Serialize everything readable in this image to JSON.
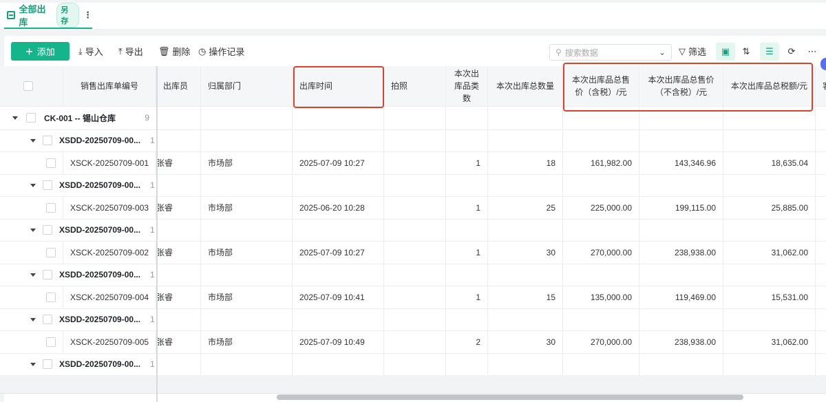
{
  "tab": {
    "label": "全部出库",
    "badge": "另存"
  },
  "toolbar": {
    "add": "添加",
    "import": "导入",
    "export": "导出",
    "delete": "删除",
    "log": "操作记录",
    "search_placeholder": "搜索数据",
    "filter": "筛选"
  },
  "columns": [
    "销售出库单编号",
    "出库员",
    "归属部门",
    "出库时间",
    "拍照",
    "本次出库品类数",
    "本次出库总数量",
    "本次出库品总售价（含税）/元",
    "本次出库品总售价（不含税）/元",
    "本次出库品总税额/元",
    "客"
  ],
  "group": {
    "label": "CK-001 -- 锡山仓库",
    "count": "9"
  },
  "orders": [
    {
      "order": "XSDD-20250709-00...",
      "count": "1",
      "out": "XSCK-20250709-001",
      "staff": "张睿",
      "dept": "市场部",
      "time": "2025-07-09 10:27",
      "kinds": "1",
      "qty": "18",
      "gross": "161,982.00",
      "net": "143,346.96",
      "tax": "18,635.04"
    },
    {
      "order": "XSDD-20250709-00...",
      "count": "1",
      "out": "XSCK-20250709-003",
      "staff": "张睿",
      "dept": "市场部",
      "time": "2025-06-20 10:28",
      "kinds": "1",
      "qty": "25",
      "gross": "225,000.00",
      "net": "199,115.00",
      "tax": "25,885.00"
    },
    {
      "order": "XSDD-20250709-00...",
      "count": "1",
      "out": "XSCK-20250709-002",
      "staff": "张睿",
      "dept": "市场部",
      "time": "2025-07-09 10:27",
      "kinds": "1",
      "qty": "30",
      "gross": "270,000.00",
      "net": "238,938.00",
      "tax": "31,062.00"
    },
    {
      "order": "XSDD-20250709-00...",
      "count": "1",
      "out": "XSCK-20250709-004",
      "staff": "张睿",
      "dept": "市场部",
      "time": "2025-07-09 10:41",
      "kinds": "1",
      "qty": "15",
      "gross": "135,000.00",
      "net": "119,469.00",
      "tax": "15,531.00"
    },
    {
      "order": "XSDD-20250709-00...",
      "count": "1",
      "out": "XSCK-20250709-005",
      "staff": "张睿",
      "dept": "市场部",
      "time": "2025-07-09 10:49",
      "kinds": "2",
      "qty": "30",
      "gross": "270,000.00",
      "net": "238,938.00",
      "tax": "31,062.00"
    },
    {
      "order": "XSDD-20250709-00...",
      "count": "1"
    }
  ]
}
